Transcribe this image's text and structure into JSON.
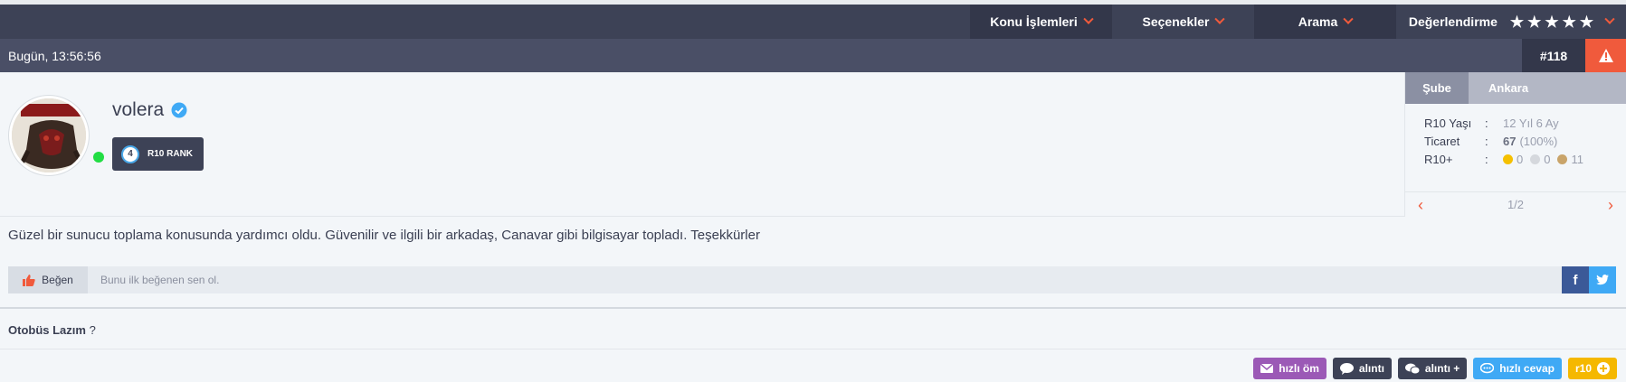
{
  "nav": {
    "items": [
      {
        "label": "Konu İşlemleri"
      },
      {
        "label": "Seçenekler"
      },
      {
        "label": "Arama"
      },
      {
        "label": "Değerlendirme"
      }
    ],
    "rating_stars": 5
  },
  "post": {
    "date": "Bugün, 13:56:56",
    "number": "#118"
  },
  "user": {
    "name": "volera",
    "rank_level": "4",
    "rank_label": "R10 RANK",
    "online": true
  },
  "side": {
    "tabs": [
      "Şube",
      "Ankara"
    ],
    "stats": [
      {
        "key": "R10 Yaşı",
        "value": "12 Yıl 6 Ay"
      },
      {
        "key": "Ticaret",
        "value_bold": "67",
        "value": "(100%)"
      },
      {
        "key": "R10+",
        "gold": "0",
        "silver": "0",
        "bronze": "11"
      }
    ],
    "pager": "1/2"
  },
  "message": "Güzel bir sunucu toplama konusunda yardımcı oldu. Güvenilir ve ilgili bir arkadaş, Canavar gibi bilgisayar topladı. Teşekkürler",
  "like": {
    "button": "Beğen",
    "text": "Bunu ilk beğenen sen ol."
  },
  "social": {
    "facebook": "f",
    "twitter": "t"
  },
  "signature": {
    "bold": "Otobüs Lazım",
    "rest": "?"
  },
  "actions": [
    {
      "label": "hızlı öm",
      "color": "#9b59b6"
    },
    {
      "label": "alıntı",
      "color": "#3d4256"
    },
    {
      "label": "alıntı +",
      "color": "#3d4256"
    },
    {
      "label": "hızlı cevap",
      "color": "#3fa9f5"
    },
    {
      "label": "r10",
      "color": "#f5b800"
    }
  ],
  "colors": {
    "accent": "#f05a3c",
    "navbar": "#3d4256",
    "infobar": "#4a4f66",
    "online": "#22dd44"
  }
}
